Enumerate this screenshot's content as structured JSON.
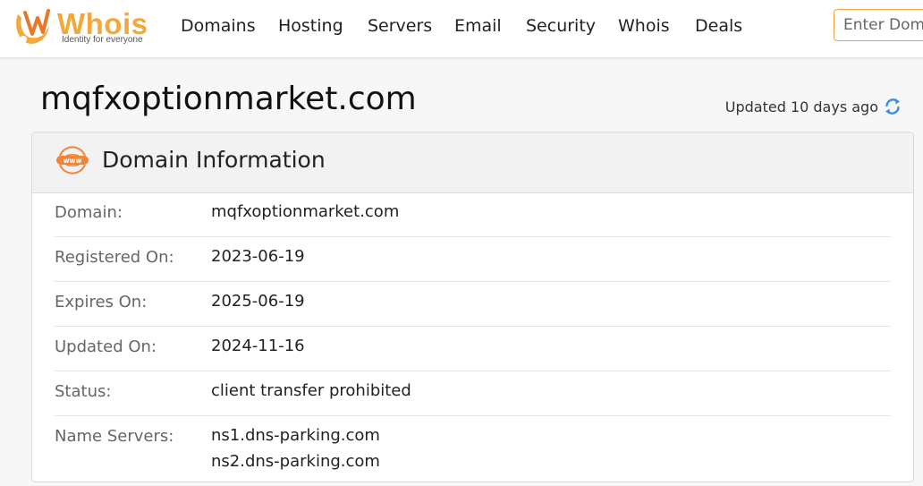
{
  "header": {
    "logo": {
      "word": "Whois",
      "tagline": "Identity for everyone"
    },
    "nav": [
      "Domains",
      "Hosting",
      "Servers",
      "Email",
      "Security",
      "Whois",
      "Deals"
    ],
    "search_placeholder": "Enter Domain or IP",
    "accent": "#f4a83a"
  },
  "page": {
    "title": "mqfxoptionmarket.com",
    "updated": "Updated 10 days ago"
  },
  "card": {
    "title": "Domain Information",
    "icon": "www-globe-icon",
    "rows": [
      {
        "label": "Domain:",
        "values": [
          "mqfxoptionmarket.com"
        ]
      },
      {
        "label": "Registered On:",
        "values": [
          "2023-06-19"
        ]
      },
      {
        "label": "Expires On:",
        "values": [
          "2025-06-19"
        ]
      },
      {
        "label": "Updated On:",
        "values": [
          "2024-11-16"
        ]
      },
      {
        "label": "Status:",
        "values": [
          "client transfer prohibited"
        ]
      },
      {
        "label": "Name Servers:",
        "values": [
          "ns1.dns-parking.com",
          "ns2.dns-parking.com"
        ]
      }
    ]
  }
}
